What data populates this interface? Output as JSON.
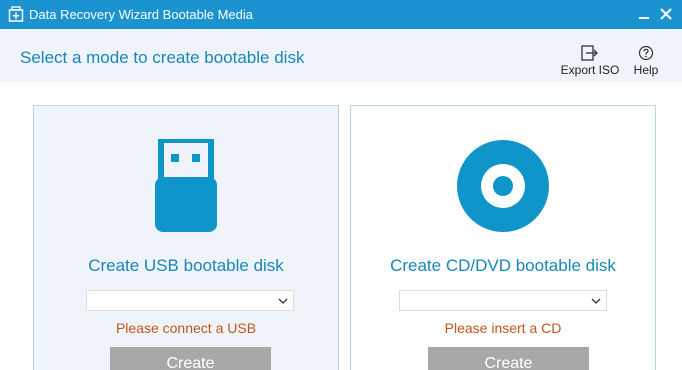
{
  "window": {
    "title": "Data Recovery Wizard Bootable Media",
    "title_bar_color": "#1a93d0"
  },
  "header": {
    "heading": "Select a mode to create bootable disk",
    "export_iso_label": "Export ISO",
    "help_label": "Help"
  },
  "usb_panel": {
    "title": "Create USB bootable disk",
    "dropdown_value": "",
    "status": "Please connect a USB",
    "create_label": "Create",
    "icon": "usb-drive-icon"
  },
  "cd_panel": {
    "title": "Create CD/DVD bootable disk",
    "dropdown_value": "",
    "status": "Please insert a CD",
    "create_label": "Create",
    "icon": "cd-disc-icon"
  },
  "colors": {
    "accent": "#1a86b7",
    "icon_blue": "#0f95c9",
    "status_orange": "#c0561b",
    "button_disabled": "#a8a8a8"
  }
}
